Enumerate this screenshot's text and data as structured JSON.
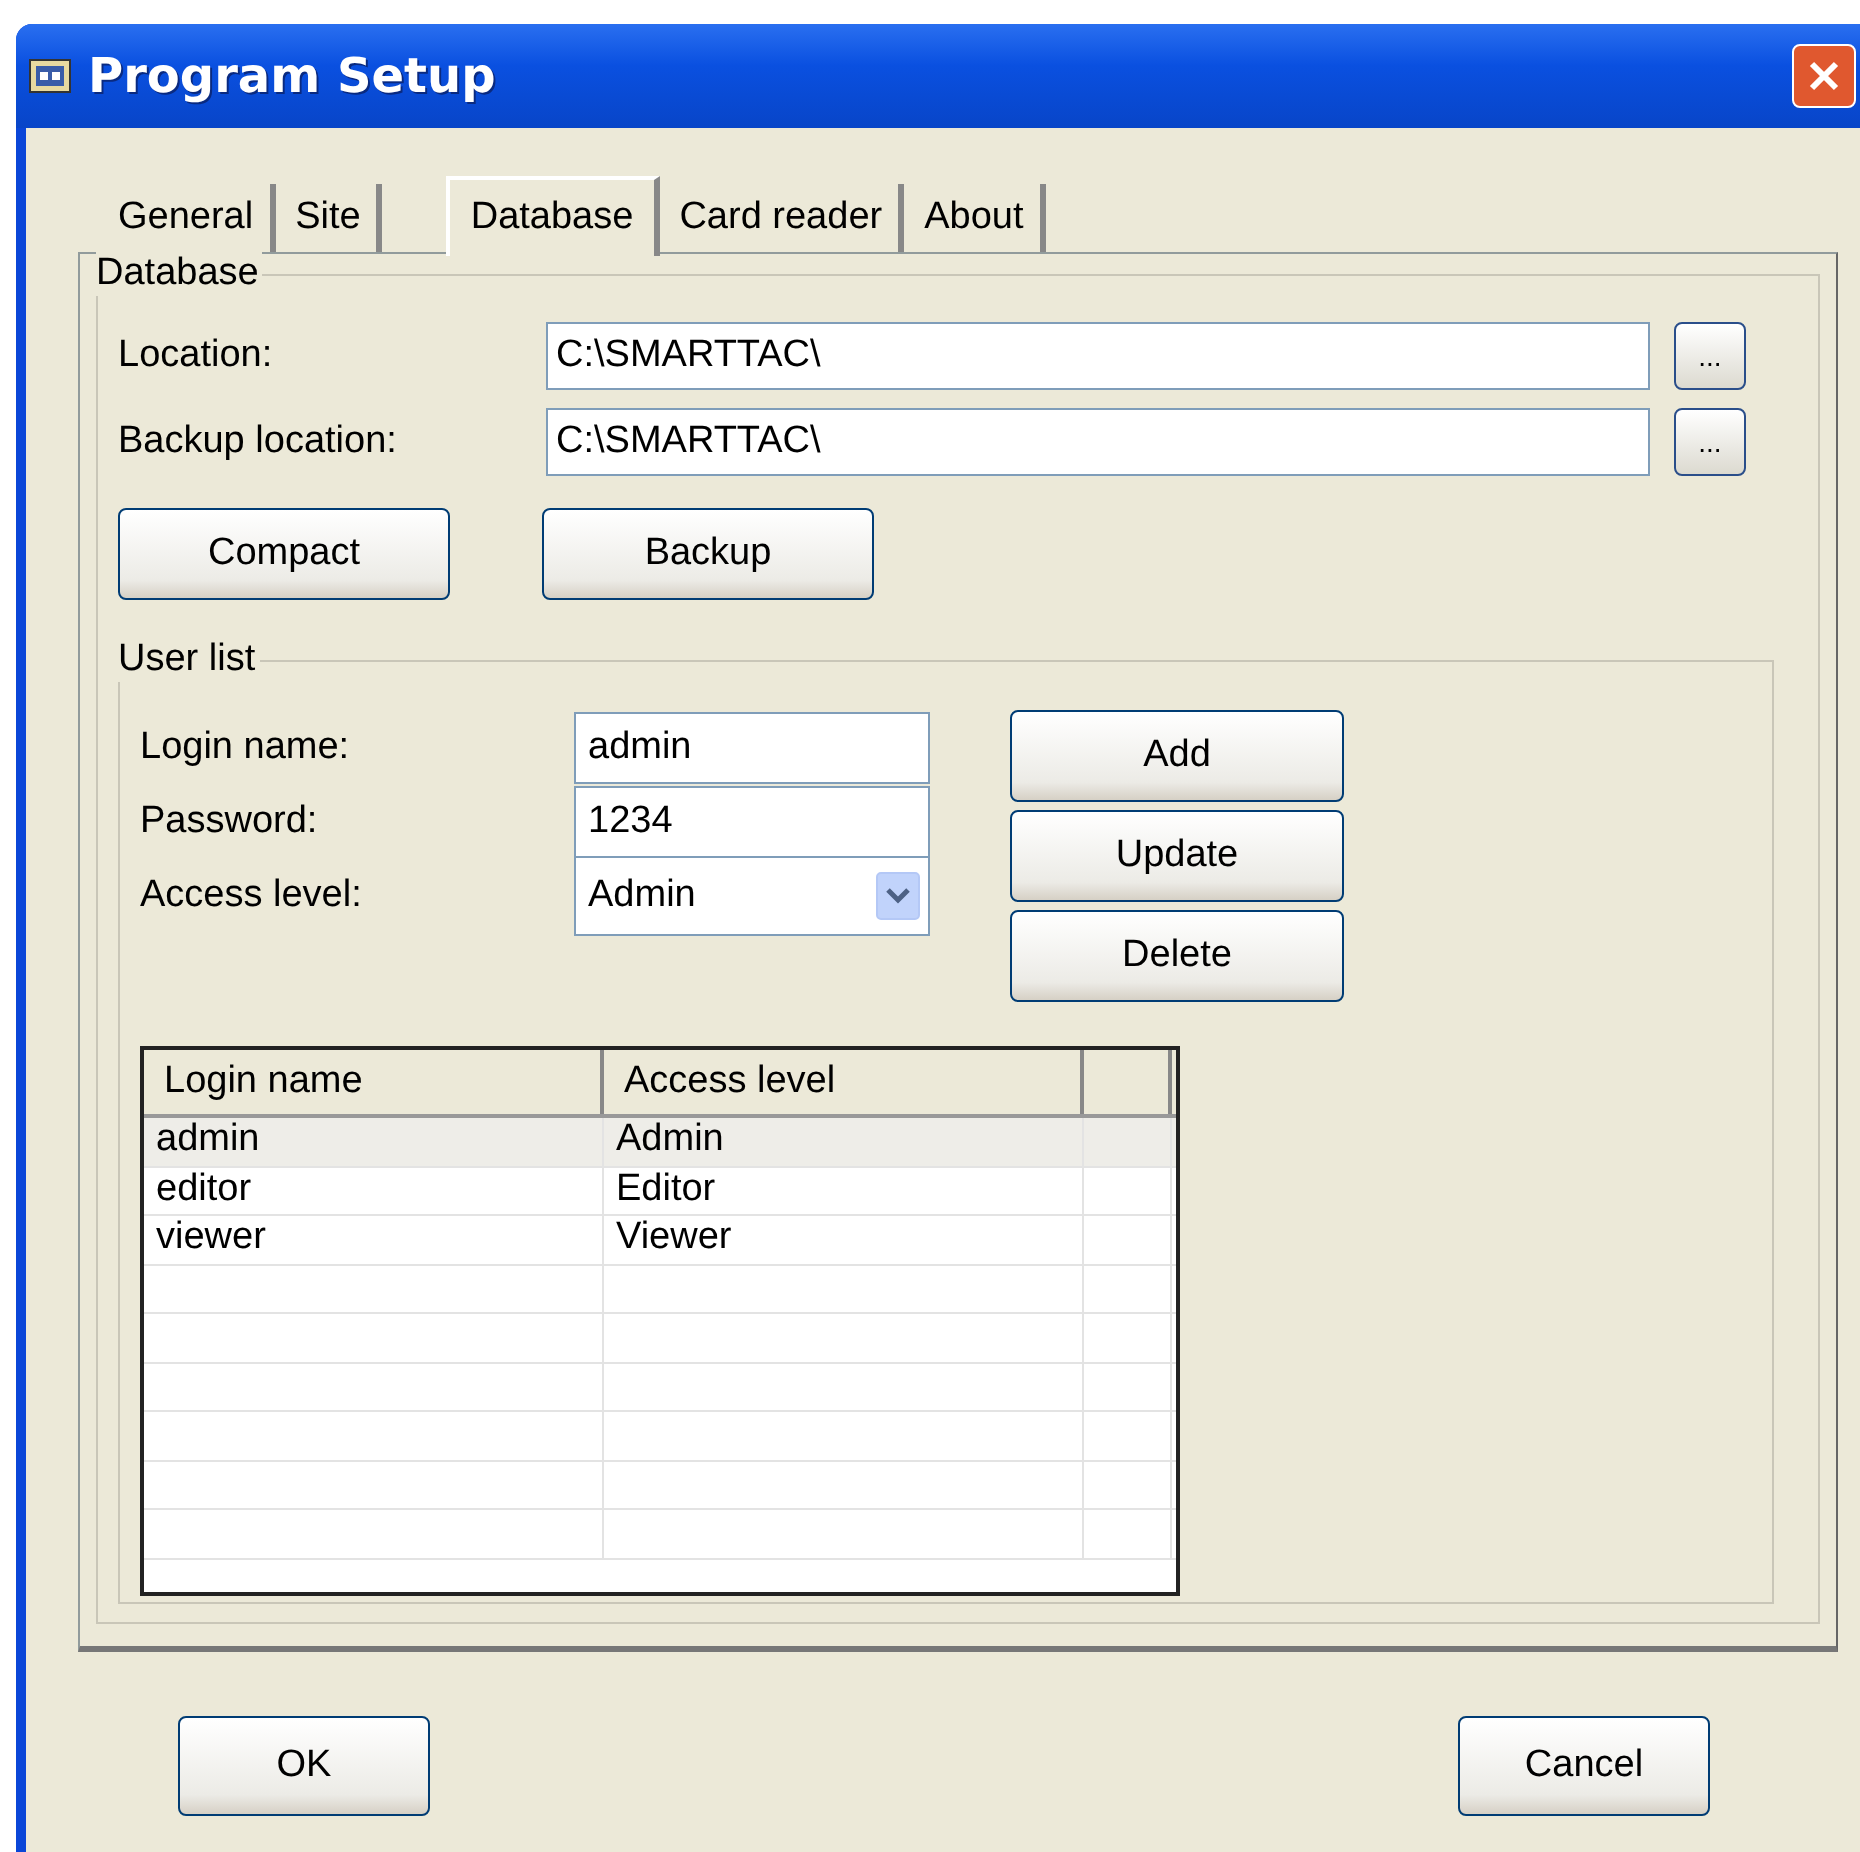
{
  "window": {
    "title": "Program Setup"
  },
  "tabs": [
    {
      "label": "General",
      "selected": false
    },
    {
      "label": "Site",
      "selected": false
    },
    {
      "label": "Database",
      "selected": true
    },
    {
      "label": "Card reader",
      "selected": false
    },
    {
      "label": "About",
      "selected": false
    }
  ],
  "database_group": {
    "title": "Database",
    "fields": [
      {
        "label": "Location:",
        "value": "C:\\SMARTTAC\\",
        "browse": "..."
      },
      {
        "label": "Backup location:",
        "value": "C:\\SMARTTAC\\",
        "browse": "..."
      }
    ],
    "buttons": [
      "Compact",
      "Backup"
    ]
  },
  "user_list": {
    "title": "User list",
    "login_label": "Login name:",
    "login_value": "admin",
    "password_label": "Password:",
    "password_value": "1234",
    "access_label": "Access level:",
    "access_value": "Admin",
    "buttons": [
      "Add",
      "Update",
      "Delete"
    ],
    "table": {
      "columns": [
        "Login name",
        "Access level"
      ],
      "rows": [
        {
          "cells": [
            "admin",
            "Admin"
          ],
          "selected": true
        },
        {
          "cells": [
            "editor",
            "Editor"
          ],
          "selected": false
        },
        {
          "cells": [
            "viewer",
            "Viewer"
          ],
          "selected": false
        }
      ]
    }
  },
  "footer_buttons": [
    "OK",
    "Cancel"
  ]
}
